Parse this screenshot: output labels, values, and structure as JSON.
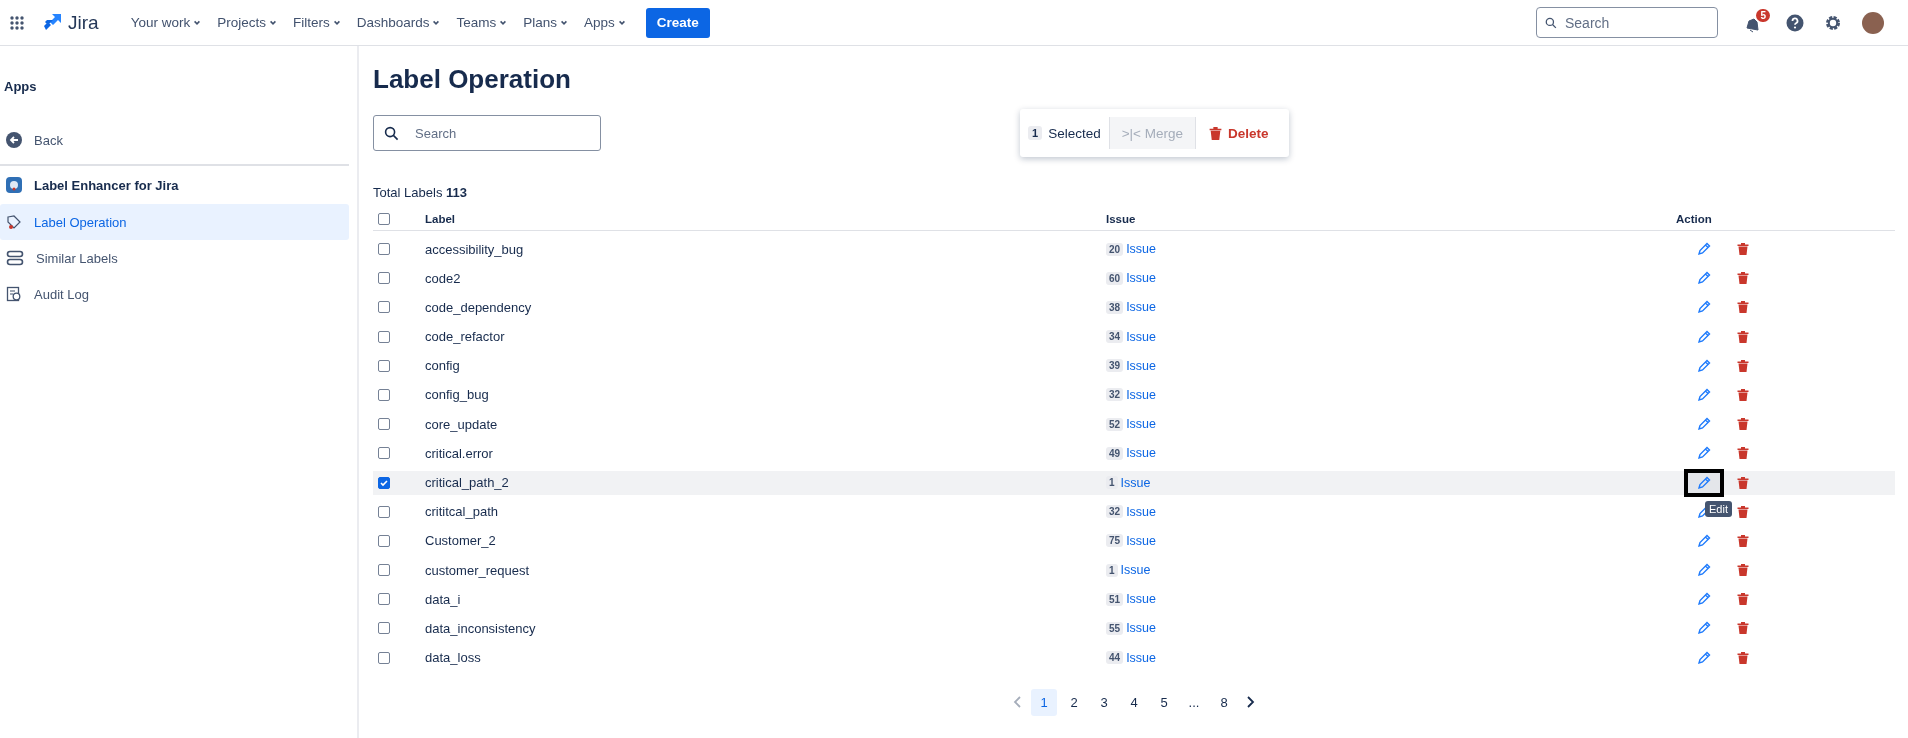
{
  "topnav": {
    "product": "Jira",
    "menus": [
      "Your work",
      "Projects",
      "Filters",
      "Dashboards",
      "Teams",
      "Plans",
      "Apps"
    ],
    "create": "Create",
    "search_placeholder": "Search",
    "notifications": "5"
  },
  "sidebar": {
    "heading": "Apps",
    "back": "Back",
    "app_name": "Label Enhancer for Jira",
    "items": [
      {
        "label": "Label Operation",
        "selected": true
      },
      {
        "label": "Similar Labels",
        "selected": false
      },
      {
        "label": "Audit Log",
        "selected": false
      }
    ]
  },
  "page": {
    "title": "Label Operation",
    "search_placeholder": "Search",
    "total_label": "Total Labels",
    "total": "113"
  },
  "selection_bar": {
    "count": "1",
    "selected_text": "Selected",
    "merge": ">|< Merge",
    "merge_disabled": true,
    "delete": "Delete"
  },
  "table": {
    "columns": [
      "Label",
      "Issue",
      "Action"
    ],
    "all_selected": false,
    "rows": [
      {
        "label": "accessibility_bug",
        "count": "20",
        "issue": "Issue",
        "selected": false,
        "tooltip": null
      },
      {
        "label": "code2",
        "count": "60",
        "issue": "Issue",
        "selected": false,
        "tooltip": null
      },
      {
        "label": "code_dependency",
        "count": "38",
        "issue": "Issue",
        "selected": false,
        "tooltip": null
      },
      {
        "label": "code_refactor",
        "count": "34",
        "issue": "Issue",
        "selected": false,
        "tooltip": null
      },
      {
        "label": "config",
        "count": "39",
        "issue": "Issue",
        "selected": false,
        "tooltip": null
      },
      {
        "label": "config_bug",
        "count": "32",
        "issue": "Issue",
        "selected": false,
        "tooltip": null
      },
      {
        "label": "core_update",
        "count": "52",
        "issue": "Issue",
        "selected": false,
        "tooltip": null
      },
      {
        "label": "critical.error",
        "count": "49",
        "issue": "Issue",
        "selected": false,
        "tooltip": null
      },
      {
        "label": "critical_path_2",
        "count": "1",
        "issue": "Issue",
        "selected": true,
        "tooltip": "Edit"
      },
      {
        "label": "crititcal_path",
        "count": "32",
        "issue": "Issue",
        "selected": false,
        "tooltip": null
      },
      {
        "label": "Customer_2",
        "count": "75",
        "issue": "Issue",
        "selected": false,
        "tooltip": null
      },
      {
        "label": "customer_request",
        "count": "1",
        "issue": "Issue",
        "selected": false,
        "tooltip": null
      },
      {
        "label": "data_i",
        "count": "51",
        "issue": "Issue",
        "selected": false,
        "tooltip": null
      },
      {
        "label": "data_inconsistency",
        "count": "55",
        "issue": "Issue",
        "selected": false,
        "tooltip": null
      },
      {
        "label": "data_loss",
        "count": "44",
        "issue": "Issue",
        "selected": false,
        "tooltip": null
      }
    ]
  },
  "pagination": {
    "pages": [
      {
        "label": "1",
        "selected": true
      },
      {
        "label": "2",
        "selected": false
      },
      {
        "label": "3",
        "selected": false
      },
      {
        "label": "4",
        "selected": false
      },
      {
        "label": "5",
        "selected": false
      },
      {
        "label": "...",
        "selected": false
      },
      {
        "label": "8",
        "selected": false
      }
    ],
    "prev_disabled": true
  }
}
